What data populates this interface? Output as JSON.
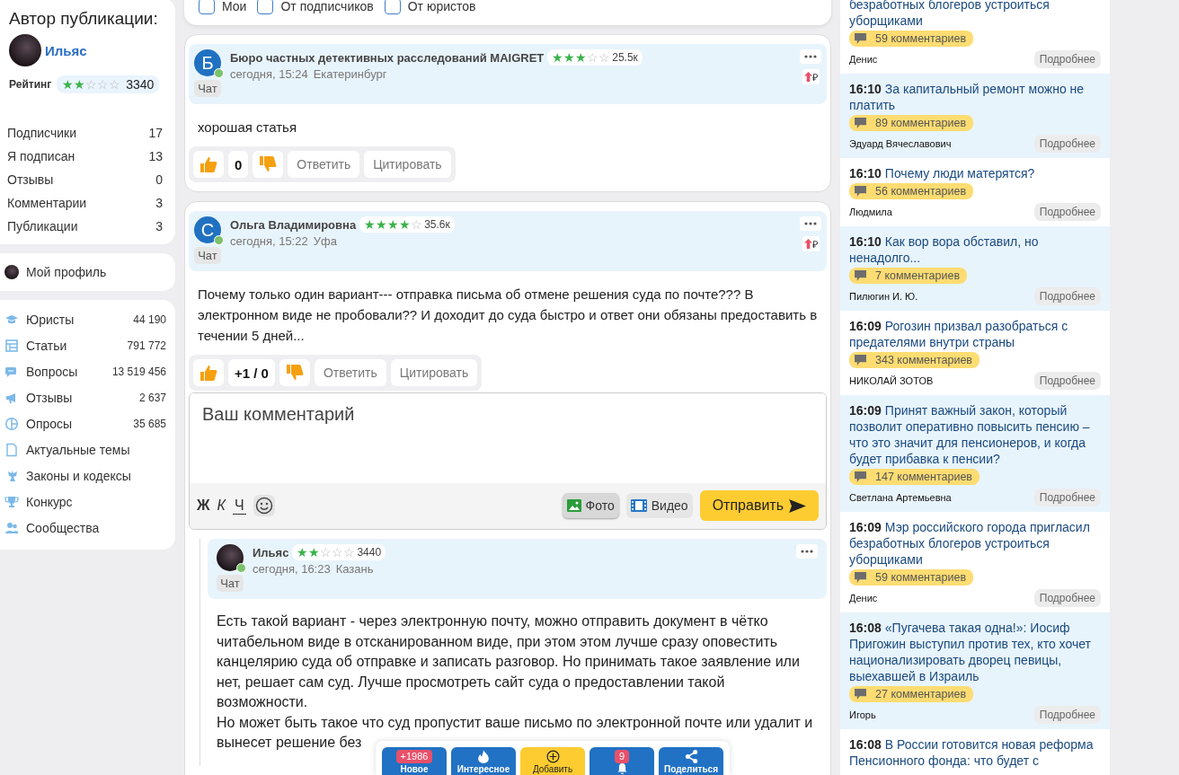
{
  "author": {
    "heading": "Автор публикации:",
    "name": "Ильяс",
    "rating_label": "Рейтинг",
    "stars": 2,
    "rating": "3340"
  },
  "stats": [
    {
      "label": "Подписчики",
      "value": "17"
    },
    {
      "label": "Я подписан",
      "value": "13"
    },
    {
      "label": "Отзывы",
      "value": "0"
    },
    {
      "label": "Комментарии",
      "value": "3"
    },
    {
      "label": "Публикации",
      "value": "3"
    }
  ],
  "profile_link": "Мой профиль",
  "nav": [
    {
      "label": "Юристы",
      "count": "44 190"
    },
    {
      "label": "Статьи",
      "count": "791 772"
    },
    {
      "label": "Вопросы",
      "count": "13 519 456"
    },
    {
      "label": "Отзывы",
      "count": "2 637"
    },
    {
      "label": "Опросы",
      "count": "35 685"
    },
    {
      "label": "Актуальные темы"
    },
    {
      "label": "Законы и кодексы"
    },
    {
      "label": "Конкурс"
    },
    {
      "label": "Сообщества"
    }
  ],
  "filters": [
    {
      "label": "Мои",
      "checked": false
    },
    {
      "label": "От подписчиков",
      "checked": false
    },
    {
      "label": "От юристов",
      "checked": false
    }
  ],
  "comments": [
    {
      "avatar": {
        "kind": "letter",
        "letter": "Б"
      },
      "online": true,
      "author": "Бюро частных детективных расследований MAIGRET",
      "stars": 3,
      "rating": "25.5к",
      "time": "сегодня, 15:24",
      "city": "Екатеринбург",
      "chat": "Чат",
      "boost": "₽",
      "text": "хорошая статья",
      "score": "0",
      "reply": "Ответить",
      "quote": "Цитировать"
    },
    {
      "avatar": {
        "kind": "letter",
        "letter": "С"
      },
      "online": true,
      "author": "Ольга Владимировна",
      "stars": 4,
      "rating": "35.6к",
      "time": "сегодня, 15:22",
      "city": "Уфа",
      "chat": "Чат",
      "boost": "₽",
      "text": "Почему только один вариант--- отправка письма об отмене решения суда по почте??? В электронном виде не пробовали?? И доходит до суда быстро и ответ они обязаны предоставить в течении 5 дней...",
      "score": "+1 / 0",
      "reply": "Ответить",
      "quote": "Цитировать"
    }
  ],
  "editor": {
    "placeholder": "Ваш комментарий",
    "bold": "Ж",
    "italic": "К",
    "underline": "Ч",
    "photo": "Фото",
    "video": "Видео",
    "send": "Отправить"
  },
  "reply": {
    "avatar": {
      "kind": "photo"
    },
    "online": true,
    "author": "Ильяс",
    "stars": 2,
    "rating": "3440",
    "time": "сегодня, 16:23",
    "city": "Казань",
    "chat": "Чат",
    "paragraphs": [
      "Есть такой вариант - через электронную почту, можно отправить документ в чётко читабельном виде в отсканированном виде, при этом этом лучше сразу оповестить канцелярию суда об отправке и записать разговор. Но принимать такое заявление или нет, решает сам суд. Лучше просмотреть сайт суда о предоставлении такой возможности.",
      "Но может быть такое что суд пропустит ваше письмо по электронной почте или удалит и вынесет решение без"
    ]
  },
  "feed": [
    {
      "title": "безработных блогеров устроиться уборщиками",
      "comments": "59 комментариев",
      "author": "Денис",
      "more": "Подробнее"
    },
    {
      "time": "16:10",
      "title": "За капитальный ремонт можно не платить",
      "comments": "89 комментариев",
      "author": "Эдуард Вячеславович",
      "more": "Подробнее"
    },
    {
      "time": "16:10",
      "title": "Почему люди матерятся?",
      "comments": "56 комментариев",
      "author": "Людмила",
      "more": "Подробнее"
    },
    {
      "time": "16:10",
      "title": "Как вор вора обставил, но ненадолго...",
      "comments": "7 комментариев",
      "author": "Пилюгин И. Ю.",
      "more": "Подробнее"
    },
    {
      "time": "16:09",
      "title": "Рогозин призвал разобраться с предателями внутри страны",
      "comments": "343 комментариев",
      "author": "НИКОЛАЙ ЗОТОВ",
      "more": "Подробнее"
    },
    {
      "time": "16:09",
      "title": "Принят важный закон, который позволит оперативно повысить пенсию – что это значит для пенсионеров, и когда будет прибавка к пенсии?",
      "comments": "147 комментариев",
      "author": "Светлана Артемьевна",
      "more": "Подробнее"
    },
    {
      "time": "16:09",
      "title": "Мэр российского города пригласил безработных блогеров устроиться уборщиками",
      "comments": "59 комментариев",
      "author": "Денис",
      "more": "Подробнее"
    },
    {
      "time": "16:08",
      "title": "«Пугачева такая одна!»: Иосиф Пригожин выступил против тех, кто хочет национализировать дворец певицы, выехавшей в Израиль",
      "comments": "27 комментариев",
      "author": "Игорь",
      "more": "Подробнее"
    },
    {
      "time": "16:08",
      "title": "В России готовится новая реформа Пенсионного фонда: что будет с"
    }
  ],
  "bottom_bar": [
    {
      "kind": "new",
      "badge": "+1986",
      "label": "Новое"
    },
    {
      "kind": "hot",
      "label": "Интересное"
    },
    {
      "kind": "add",
      "label": "Добавить"
    },
    {
      "kind": "notify",
      "badge": "9"
    },
    {
      "kind": "share",
      "label": "Поделиться"
    }
  ]
}
